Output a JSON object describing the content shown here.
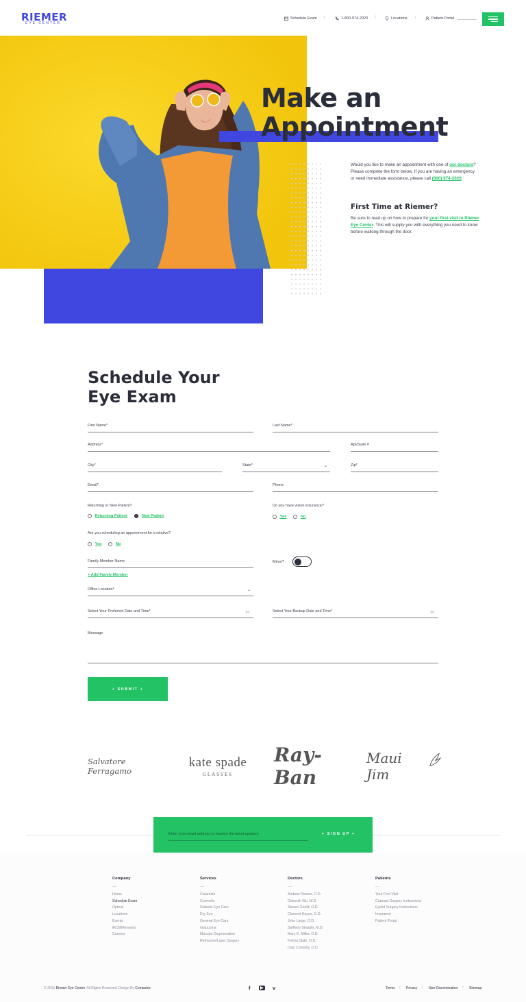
{
  "header": {
    "logo": "RIEMER",
    "logo_sub": "EYE CENTER",
    "nav": {
      "schedule": "Schedule Exam",
      "phone": "1-800-974-2020",
      "locations": "Locations",
      "portal": "Patient Portal"
    },
    "sep": "/",
    "icons": {
      "schedule": "calendar-icon",
      "phone": "phone-icon",
      "locations": "location-pin-icon",
      "portal": "user-icon",
      "menu": "hamburger-menu-icon"
    }
  },
  "hero": {
    "title_line1": "Make an",
    "title_line2": "Appointment",
    "intro_pre": "Would you like to make an appointment with one of ",
    "intro_link": "our doctors",
    "intro_mid": "? Please complete the form below. If you are having an emergency or need immediate assistance, please call ",
    "intro_phone": "(800) 974-2020",
    "intro_end": ".",
    "first_title": "First Time at Riemer?",
    "first_pre": "Be sure to read up on how to prepare for ",
    "first_link": "your first visit to Riemer Eye Center",
    "first_post": ". This will supply you with everything you need to know before walking through the door."
  },
  "form": {
    "title_line1": "Schedule Your",
    "title_line2": "Eye Exam",
    "first_name": "First Name*",
    "last_name": "Last Name*",
    "address": "Address*",
    "apt": "Apt/Suite #",
    "city": "City*",
    "state": "State*",
    "zip": "Zip*",
    "email": "Email*",
    "phone": "Phone",
    "patient_q": "Returning or New Patient?",
    "returning": "Returning Patient",
    "new_patient": "New Patient",
    "insurance_q": "Do you have vision insurance?",
    "yes": "Yes",
    "no": "No",
    "relative_q": "Are you scheduling an appointment for a relative?",
    "family_name": "Family Member Name",
    "minor": "Minor?",
    "add_family": "+ Add Family Member",
    "office": "Office Location*",
    "preferred": "Select Your Preferred Date and Time*",
    "backup": "Select Your Backup Date and Time*",
    "message": "Message",
    "submit": "+ SUBMIT +",
    "chevron": "⌄",
    "calendar": "▭",
    "check": "✓"
  },
  "brands": {
    "ferragamo": "Salvatore Ferragamo",
    "kate_1": "kate spade",
    "kate_2": "GLASSES",
    "rayban": "Ray-Ban",
    "maui": "Maui Jim"
  },
  "newsletter": {
    "placeholder": "Enter your email address to receive the latest updates",
    "button": "+ SIGN UP +"
  },
  "footer": {
    "dash": "—",
    "columns": [
      {
        "title": "Company",
        "items": [
          "Home",
          "Schedule Exam",
          "Optical",
          "Locations",
          "Events",
          "iRCM|Rewards",
          "Careers"
        ]
      },
      {
        "title": "Services",
        "items": [
          "Cataracts",
          "Cosmetic",
          "Diabetic Eye Care",
          "Dry Eye",
          "General Eye Care",
          "Glaucoma",
          "Macular Degeneration",
          "Refractive/Laser Surgery"
        ]
      },
      {
        "title": "Doctors",
        "items": [
          "Andrew Riemer, O.D.",
          "Deborah Wu, M.D.",
          "Steven Gould, O.D.",
          "Clement Hayes, O.D.",
          "John Large, O.D.",
          "Steffany Straight, M.D.",
          "Mary E. Miller, O.D.",
          "Felicia Slate, O.D.",
          "Clay Connolly, O.D."
        ]
      },
      {
        "title": "Patients",
        "items": [
          "Your First Visit",
          "Cataract Surgery Instructions",
          "Eyelid Surgery Instructions",
          "Insurance",
          "Patient Portal"
        ]
      }
    ],
    "copy_pre": "© 2016 ",
    "copy_brand": "Riemer Eye Center",
    "copy_mid": ". All Rights Reserved. Design By ",
    "copy_design": "Compulse",
    "social": {
      "facebook": "f",
      "youtube": "▶",
      "vimeo": "v"
    },
    "links": {
      "terms": "Terms",
      "privacy": "Privacy",
      "nondisc": "Non-Discrimination",
      "sitemap": "Sitemap"
    }
  }
}
